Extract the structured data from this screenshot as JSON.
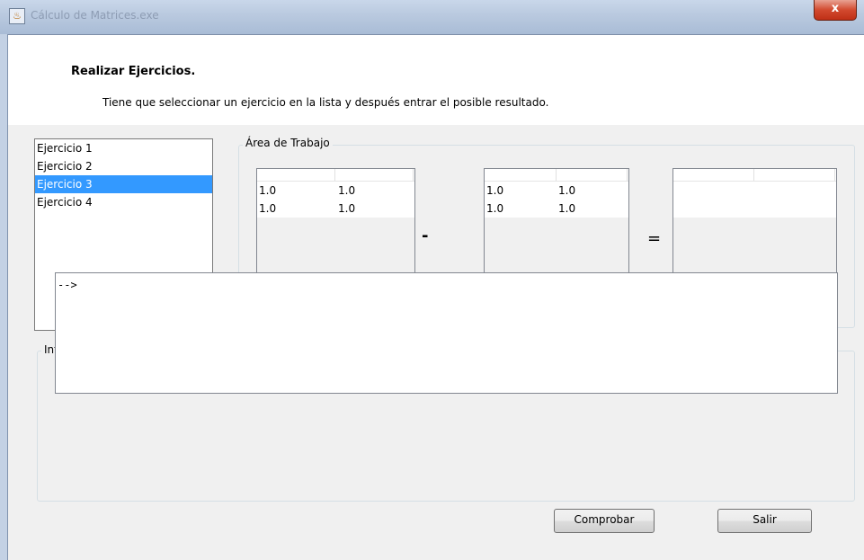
{
  "window": {
    "title": "Cálculo de Matrices.exe",
    "close_label": "x"
  },
  "header": {
    "heading": "Realizar Ejercicios.",
    "instructions": "Tiene que seleccionar un ejercicio en la lista y después entrar el posible resultado."
  },
  "exercise_list": {
    "items": [
      "Ejercicio 1",
      "Ejercicio 2",
      "Ejercicio 3",
      "Ejercicio 4"
    ],
    "selected": "Ejercicio 3"
  },
  "work_area": {
    "title": "Área de Trabajo",
    "matrix_a": [
      [
        "1.0",
        "1.0"
      ],
      [
        "1.0",
        "1.0"
      ]
    ],
    "operator": "-",
    "matrix_b": [
      [
        "1.0",
        "1.0"
      ],
      [
        "1.0",
        "1.0"
      ]
    ],
    "equals": "="
  },
  "info": {
    "title": "Información",
    "text": "-->"
  },
  "buttons": {
    "check": "Comprobar",
    "exit": "Salir"
  },
  "colors": {
    "selection": "#3399ff",
    "panel_bg": "#f0f0f0",
    "close_button": "#c8391d"
  }
}
